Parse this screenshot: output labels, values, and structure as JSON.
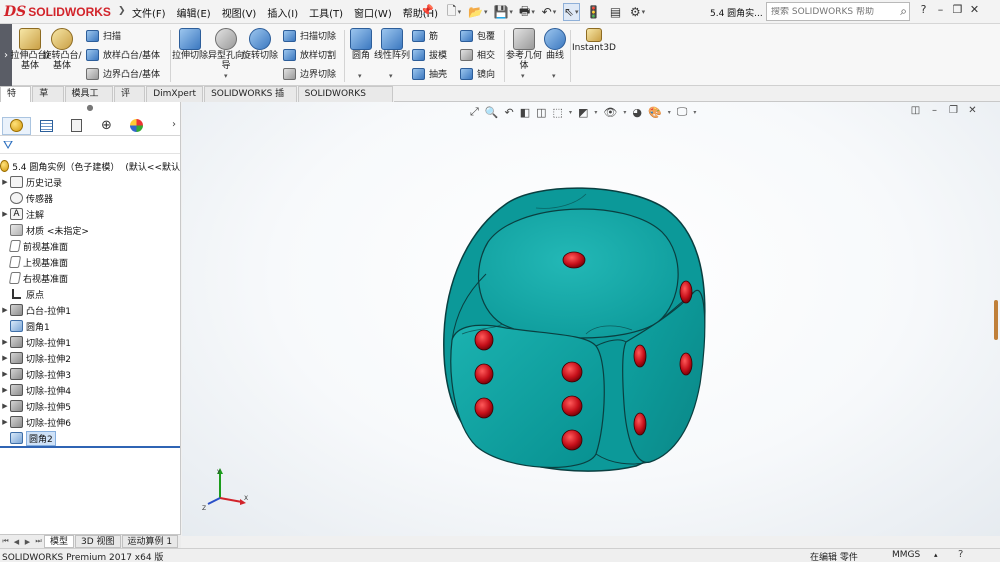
{
  "app": {
    "logo_text": "SOLIDWORKS",
    "menus": [
      "文件(F)",
      "编辑(E)",
      "视图(V)",
      "插入(I)",
      "工具(T)",
      "窗口(W)",
      "帮助(H)"
    ],
    "document_title": "5.4 圆角实...",
    "search_placeholder": "搜索 SOLIDWORKS 帮助"
  },
  "command_manager": {
    "buttons": [
      {
        "label": "拉伸凸台/基体",
        "icon": "extruded-boss-icon"
      },
      {
        "label": "旋转凸台/基体",
        "icon": "revolved-boss-icon"
      },
      {
        "label": "扫描",
        "icon": "sweep-icon"
      },
      {
        "label": "放样凸台/基体",
        "icon": "loft-icon"
      },
      {
        "label": "边界凸台/基体",
        "icon": "boundary-boss-icon"
      },
      {
        "label": "拉伸切除",
        "icon": "extruded-cut-icon"
      },
      {
        "label": "异型孔向导",
        "icon": "hole-wizard-icon"
      },
      {
        "label": "旋转切除",
        "icon": "revolved-cut-icon"
      },
      {
        "label": "扫描切除",
        "icon": "swept-cut-icon"
      },
      {
        "label": "放样切割",
        "icon": "lofted-cut-icon"
      },
      {
        "label": "边界切除",
        "icon": "boundary-cut-icon"
      },
      {
        "label": "圆角",
        "icon": "fillet-icon"
      },
      {
        "label": "线性阵列",
        "icon": "linear-pattern-icon"
      },
      {
        "label": "筋",
        "icon": "rib-icon"
      },
      {
        "label": "拔模",
        "icon": "draft-icon"
      },
      {
        "label": "抽壳",
        "icon": "shell-icon"
      },
      {
        "label": "包覆",
        "icon": "wrap-icon"
      },
      {
        "label": "相交",
        "icon": "intersect-icon"
      },
      {
        "label": "镜向",
        "icon": "mirror-icon"
      },
      {
        "label": "参考几何体",
        "icon": "reference-geometry-icon"
      },
      {
        "label": "曲线",
        "icon": "curves-icon"
      },
      {
        "label": "Instant3D",
        "icon": "instant3d-icon"
      }
    ]
  },
  "tabs": [
    "特征",
    "草图",
    "模具工具",
    "评估",
    "DimXpert",
    "SOLIDWORKS 插件",
    "SOLIDWORKS MBD"
  ],
  "feature_tree": {
    "root": {
      "name": "5.4 圆角实例（色子建模）",
      "config": "(默认<<默认"
    },
    "items": [
      {
        "label": "历史记录",
        "icon": "history-icon",
        "expandable": true
      },
      {
        "label": "传感器",
        "icon": "sensor-icon",
        "expandable": false
      },
      {
        "label": "注解",
        "icon": "annotation-icon",
        "expandable": true
      },
      {
        "label": "材质 <未指定>",
        "icon": "material-icon",
        "expandable": false
      },
      {
        "label": "前视基准面",
        "icon": "plane-icon",
        "expandable": false
      },
      {
        "label": "上视基准面",
        "icon": "plane-icon",
        "expandable": false
      },
      {
        "label": "右视基准面",
        "icon": "plane-icon",
        "expandable": false
      },
      {
        "label": "原点",
        "icon": "origin-icon",
        "expandable": false
      },
      {
        "label": "凸台-拉伸1",
        "icon": "boss-extrude-icon",
        "expandable": true
      },
      {
        "label": "圆角1",
        "icon": "fillet-feature-icon",
        "expandable": false
      },
      {
        "label": "切除-拉伸1",
        "icon": "cut-extrude-icon",
        "expandable": true
      },
      {
        "label": "切除-拉伸2",
        "icon": "cut-extrude-icon",
        "expandable": true
      },
      {
        "label": "切除-拉伸3",
        "icon": "cut-extrude-icon",
        "expandable": true
      },
      {
        "label": "切除-拉伸4",
        "icon": "cut-extrude-icon",
        "expandable": true
      },
      {
        "label": "切除-拉伸5",
        "icon": "cut-extrude-icon",
        "expandable": true
      },
      {
        "label": "切除-拉伸6",
        "icon": "cut-extrude-icon",
        "expandable": true
      },
      {
        "label": "圆角2",
        "icon": "fillet-feature-icon",
        "expandable": false,
        "selected": true
      }
    ]
  },
  "bottom_tabs": [
    "模型",
    "3D 视图",
    "运动算例 1"
  ],
  "status": {
    "left": "SOLIDWORKS Premium 2017 x64 版",
    "editing": "在编辑 零件",
    "units": "MMGS"
  },
  "colors": {
    "dice_body": "#0fa3a3",
    "dice_dark": "#0a6f71",
    "pips": "#c6101a",
    "selection": "#cfe2f8",
    "accent": "#2f64b4"
  }
}
